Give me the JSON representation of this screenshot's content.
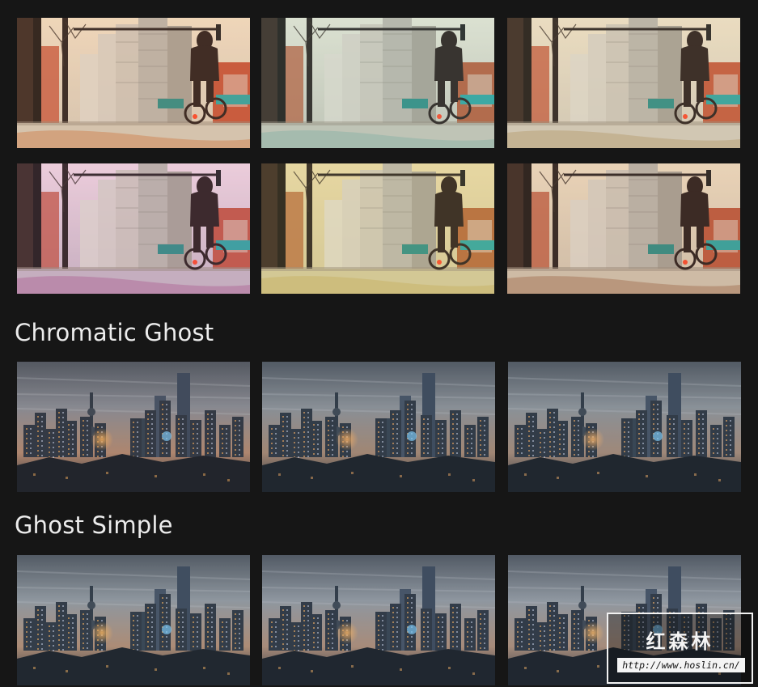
{
  "sections": [
    {
      "title": "",
      "thumbnails": [
        {
          "sky": "#f5e3c8",
          "ground": "#d7cdbb",
          "accent": "#c9553a",
          "tint": "#d08a5a"
        },
        {
          "sky": "#e8e8d8",
          "ground": "#c7c6b9",
          "accent": "#b9603e",
          "tint": "#8fb5a8"
        },
        {
          "sky": "#f3e6cc",
          "ground": "#d6cdbd",
          "accent": "#c75a3c",
          "tint": "#b9a47a"
        },
        {
          "sky": "#f6dce6",
          "ground": "#c9b8c5",
          "accent": "#c55844",
          "tint": "#b06f9a"
        },
        {
          "sky": "#ecdcab",
          "ground": "#d6cb9c",
          "accent": "#b96a3c",
          "tint": "#c9b56a"
        },
        {
          "sky": "#f4e2c6",
          "ground": "#d4c6b2",
          "accent": "#c05a3d",
          "tint": "#a87b5c"
        }
      ]
    },
    {
      "title": "Chromatic Ghost",
      "thumbnails": [
        {
          "sky": "#8a8e96",
          "horizon": "#b58a70",
          "lights": "#ffb35a",
          "tint": "#7a6e6e"
        },
        {
          "sky": "#8d9299",
          "horizon": "#a88872",
          "lights": "#ffb060",
          "tint": "#6f7a80"
        },
        {
          "sky": "#8e949b",
          "horizon": "#a68a78",
          "lights": "#ffb466",
          "tint": "#6d7c84"
        }
      ]
    },
    {
      "title": "Ghost Simple",
      "thumbnails": [
        {
          "sky": "#939aa2",
          "horizon": "#b48e74",
          "lights": "#ffb55c",
          "tint": "#71808a"
        },
        {
          "sky": "#949ba3",
          "horizon": "#b08e78",
          "lights": "#ffb560",
          "tint": "#6f7f89"
        },
        {
          "sky": "#959ca4",
          "horizon": "#ae8f7a",
          "lights": "#ffb865",
          "tint": "#6e7f8a"
        }
      ]
    }
  ],
  "watermark": {
    "title": "红森林",
    "url": "http://www.hoslin.cn/"
  }
}
